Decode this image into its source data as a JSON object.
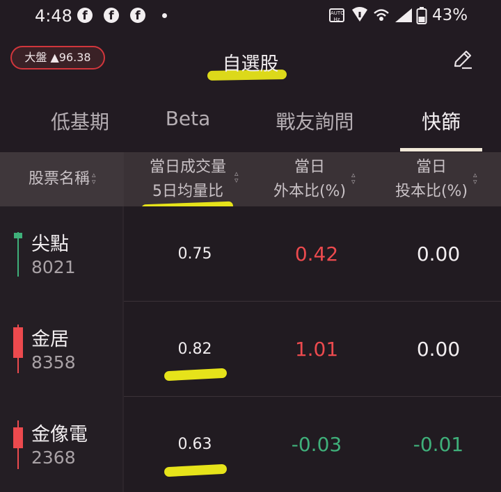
{
  "status_bar": {
    "time": "4:48",
    "battery": "43%",
    "icons": [
      "facebook-icon",
      "facebook-icon",
      "facebook-icon",
      "notification-dot",
      "auto-icon",
      "wifi-icon",
      "hotspot-icon",
      "signal-icon",
      "battery-icon"
    ]
  },
  "header": {
    "index_badge": "大盤 ▲96.38",
    "title": "自選股",
    "edit_icon": "pencil-icon"
  },
  "tabs": [
    {
      "label": "低基期",
      "active": false
    },
    {
      "label": "Beta",
      "active": false
    },
    {
      "label": "戰友詢問",
      "active": false
    },
    {
      "label": "快篩",
      "active": true
    }
  ],
  "table": {
    "columns": [
      {
        "line1": "股票名稱",
        "line2": ""
      },
      {
        "line1": "當日成交量",
        "line2": "5日均量比"
      },
      {
        "line1": "當日",
        "line2": "外本比(%)"
      },
      {
        "line1": "當日",
        "line2": "投本比(%)"
      }
    ],
    "rows": [
      {
        "name": "尖點",
        "code": "8021",
        "ratio": "0.75",
        "foreign": "0.42",
        "trust": "0.00",
        "candle": "green"
      },
      {
        "name": "金居",
        "code": "8358",
        "ratio": "0.82",
        "foreign": "1.01",
        "trust": "0.00",
        "candle": "red"
      },
      {
        "name": "金像電",
        "code": "2368",
        "ratio": "0.63",
        "foreign": "-0.03",
        "trust": "-0.01",
        "candle": "red"
      }
    ]
  },
  "colors": {
    "up": "#ec4a4e",
    "down": "#3fb07a",
    "neutral": "#f2eef0",
    "highlight": "#e6e31a"
  }
}
